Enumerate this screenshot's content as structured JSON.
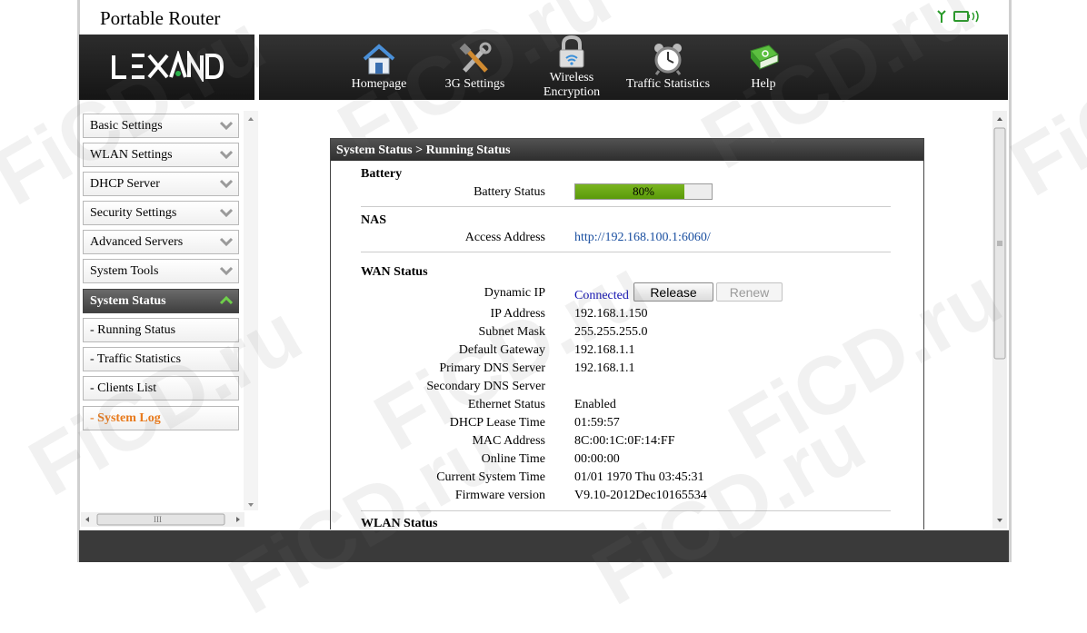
{
  "window": {
    "title": "Portable Router"
  },
  "logo": {
    "text": "LEXAND"
  },
  "status_icons": [
    "antenna-icon",
    "battery-icon"
  ],
  "nav": {
    "items": [
      {
        "label": "Homepage",
        "icon": "home-icon"
      },
      {
        "label": "3G Settings",
        "icon": "tools-icon"
      },
      {
        "label": "Wireless Encryption",
        "icon": "lock-icon"
      },
      {
        "label": "Traffic Statistics",
        "icon": "alarm-clock-icon"
      },
      {
        "label": "Help",
        "icon": "help-book-icon"
      }
    ]
  },
  "sidebar": {
    "items": [
      {
        "label": "Basic Settings"
      },
      {
        "label": "WLAN Settings"
      },
      {
        "label": "DHCP Server"
      },
      {
        "label": "Security Settings"
      },
      {
        "label": "Advanced Servers"
      },
      {
        "label": "System Tools"
      },
      {
        "label": "System Status"
      },
      {
        "label": "- Running Status"
      },
      {
        "label": "- Traffic Statistics"
      },
      {
        "label": "- Clients List"
      },
      {
        "label": "- System Log"
      }
    ],
    "hscroll_label": "III"
  },
  "panel": {
    "title": "System Status > Running Status",
    "battery": {
      "section": "Battery",
      "label": "Battery Status",
      "value": "80%",
      "level": 0.8
    },
    "nas": {
      "section": "NAS",
      "label": "Access Address",
      "value": "http://192.168.100.1:6060/"
    },
    "wan": {
      "section": "WAN Status",
      "connection_label": "Dynamic IP",
      "connection_value": "Connected",
      "release_button": "Release",
      "renew_button": "Renew",
      "rows": [
        {
          "label": "IP Address",
          "value": "192.168.1.150"
        },
        {
          "label": "Subnet Mask",
          "value": "255.255.255.0"
        },
        {
          "label": "Default Gateway",
          "value": "192.168.1.1"
        },
        {
          "label": "Primary DNS Server",
          "value": "192.168.1.1"
        },
        {
          "label": "Secondary DNS Server",
          "value": ""
        },
        {
          "label": "Ethernet Status",
          "value": "Enabled"
        },
        {
          "label": "DHCP Lease Time",
          "value": "01:59:57"
        },
        {
          "label": "MAC Address",
          "value": "8C:00:1C:0F:14:FF"
        },
        {
          "label": "Online Time",
          "value": "00:00:00"
        },
        {
          "label": "Current System Time",
          "value": "01/01 1970 Thu 03:45:31"
        },
        {
          "label": "Firmware version",
          "value": "V9.10-2012Dec10165534"
        }
      ]
    },
    "wlan": {
      "section": "WLAN Status"
    }
  },
  "watermark": "FiCD.ru",
  "colors": {
    "accent_orange": "#e87a1c",
    "battery_green": "#6aa815",
    "link_blue": "#1a4fa0"
  }
}
